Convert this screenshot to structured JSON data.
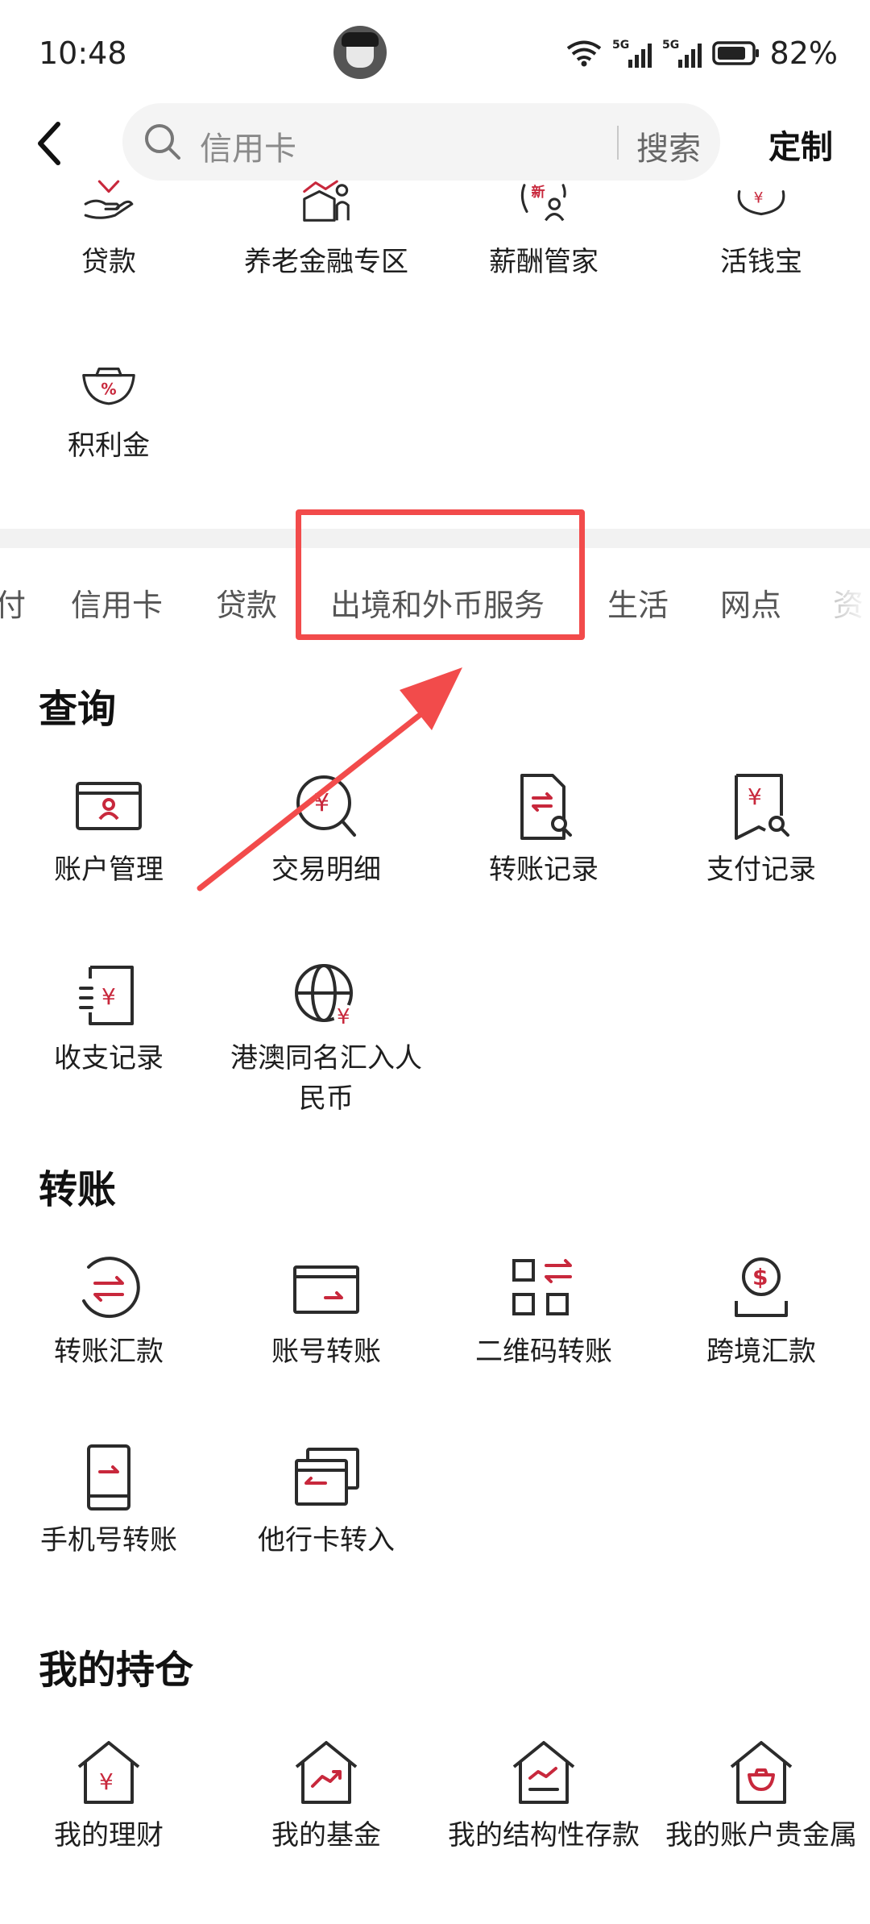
{
  "status_bar": {
    "time": "10:48",
    "battery": "82%",
    "network": [
      "5G",
      "5G"
    ]
  },
  "header": {
    "search_placeholder": "信用卡",
    "search_button": "搜索",
    "customize": "定制"
  },
  "top_grid": [
    {
      "label": "贷款",
      "icon": "loan-hand-icon"
    },
    {
      "label": "养老金融专区",
      "icon": "pension-house-icon"
    },
    {
      "label": "薪酬管家",
      "icon": "salary-new-icon"
    },
    {
      "label": "活钱宝",
      "icon": "yen-purse-icon"
    },
    {
      "label": "积利金",
      "icon": "gold-ingot-icon"
    }
  ],
  "tabs": [
    {
      "label": "付"
    },
    {
      "label": "信用卡"
    },
    {
      "label": "贷款"
    },
    {
      "label": "出境和外币服务"
    },
    {
      "label": "生活"
    },
    {
      "label": "网点"
    },
    {
      "label": "资"
    }
  ],
  "sections": [
    {
      "title": "查询",
      "items": [
        {
          "label": "账户管理",
          "icon": "account-card-icon"
        },
        {
          "label": "交易明细",
          "icon": "yen-search-icon"
        },
        {
          "label": "转账记录",
          "icon": "transfer-doc-icon"
        },
        {
          "label": "支付记录",
          "icon": "payment-record-icon"
        },
        {
          "label": "收支记录",
          "icon": "income-expense-icon"
        },
        {
          "label": "港澳同名汇入人民币",
          "icon": "globe-yen-icon"
        }
      ]
    },
    {
      "title": "转账",
      "items": [
        {
          "label": "转账汇款",
          "icon": "transfer-circle-icon"
        },
        {
          "label": "账号转账",
          "icon": "account-transfer-icon"
        },
        {
          "label": "二维码转账",
          "icon": "qr-transfer-icon"
        },
        {
          "label": "跨境汇款",
          "icon": "dollar-cross-border-icon"
        },
        {
          "label": "手机号转账",
          "icon": "phone-transfer-icon"
        },
        {
          "label": "他行卡转入",
          "icon": "other-card-icon"
        }
      ]
    },
    {
      "title": "我的持仓",
      "items": [
        {
          "label": "我的理财",
          "icon": "house-yen-icon"
        },
        {
          "label": "我的基金",
          "icon": "house-trend-icon"
        },
        {
          "label": "我的结构性存款",
          "icon": "house-chart-icon"
        },
        {
          "label": "我的账户贵金属",
          "icon": "house-gold-icon"
        }
      ]
    }
  ],
  "colors": {
    "accent": "#c8283c",
    "annotation": "#f24b4b",
    "icon_stroke": "#2b2b2b"
  }
}
